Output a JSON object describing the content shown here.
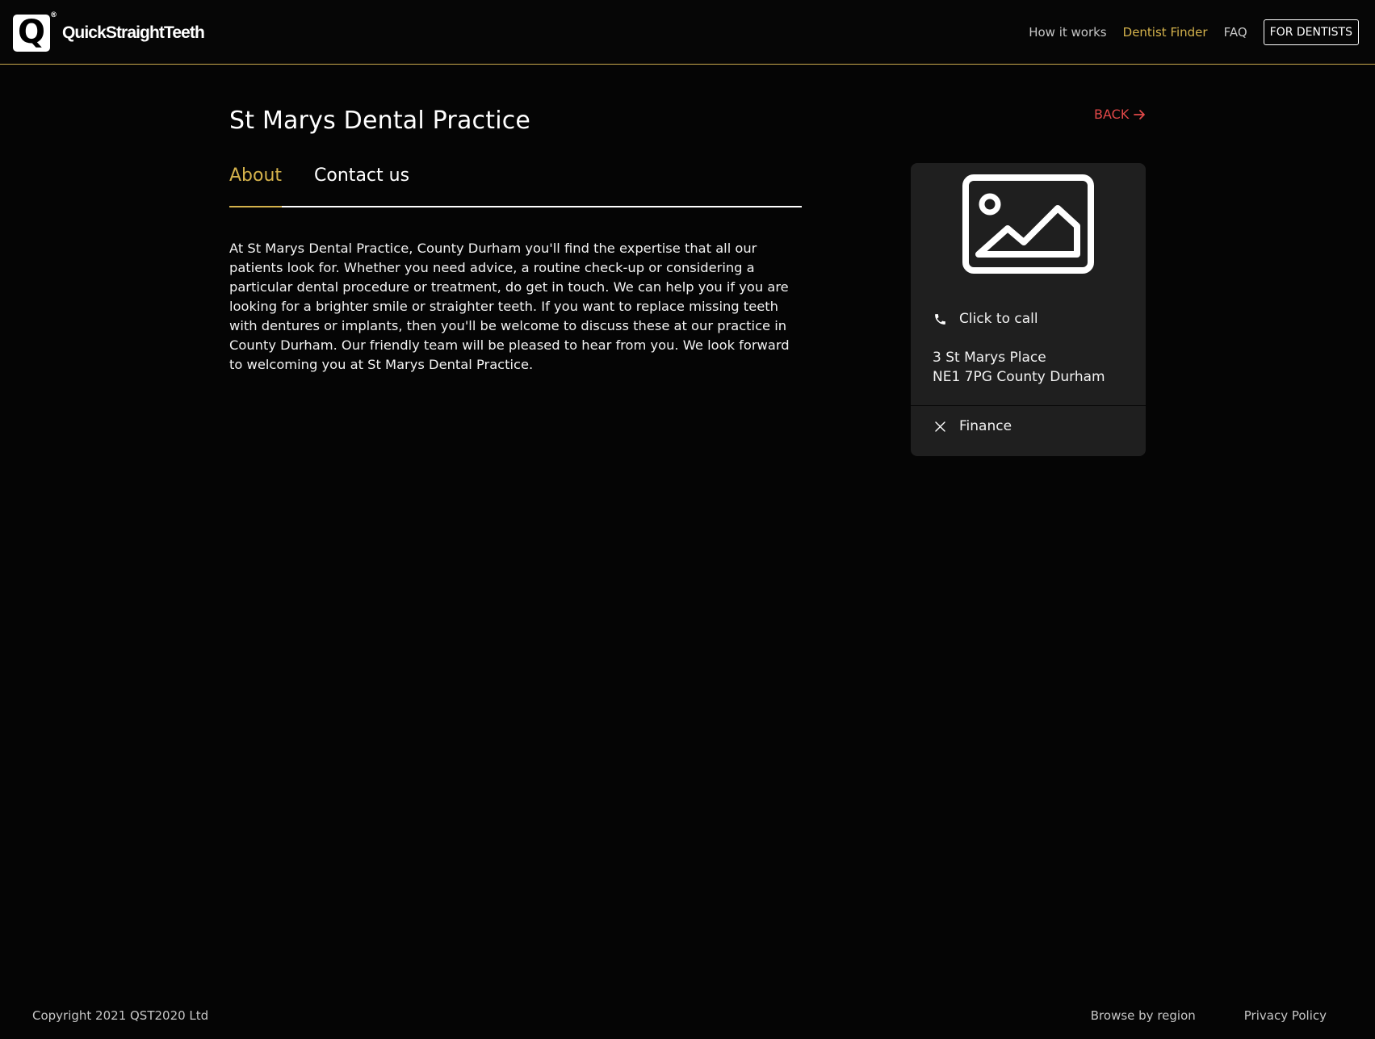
{
  "header": {
    "logo_letter": "Q",
    "logo_reg": "®",
    "brand": "QuickStraightTeeth",
    "nav": {
      "how_it_works": "How it works",
      "dentist_finder": "Dentist Finder",
      "faq": "FAQ",
      "for_dentists": "FOR DENTISTS"
    },
    "active_color": "#d4b24c"
  },
  "practice": {
    "title": "St Marys Dental Practice",
    "back_label": "BACK",
    "tabs": {
      "about": "About",
      "contact": "Contact us"
    },
    "about_text": "At St Marys Dental Practice, County Durham you'll find the expertise that all our patients look for. Whether you need advice, a routine check-up or considering a particular dental procedure or treatment, do get in touch. We can help you if you are looking for a brighter smile or straighter teeth. If you want to replace missing teeth with dentures or implants, then you'll be welcome to discuss these at our practice in County Durham. Our friendly team will be pleased to hear from you. We look forward to welcoming you at St Marys Dental Practice."
  },
  "card": {
    "image_icon": "image-placeholder-icon",
    "call_label": "Click to call",
    "address_line1": "3 St Marys Place",
    "address_line2": "NE1 7PG County Durham",
    "finance_label": "Finance"
  },
  "footer": {
    "copyright": "Copyright 2021 QST2020 Ltd",
    "browse": "Browse by region",
    "privacy": "Privacy Policy"
  },
  "colors": {
    "accent_gold": "#d4b24c",
    "back_red": "#e14848",
    "background": "#050505",
    "card": "#1f1f1f"
  }
}
